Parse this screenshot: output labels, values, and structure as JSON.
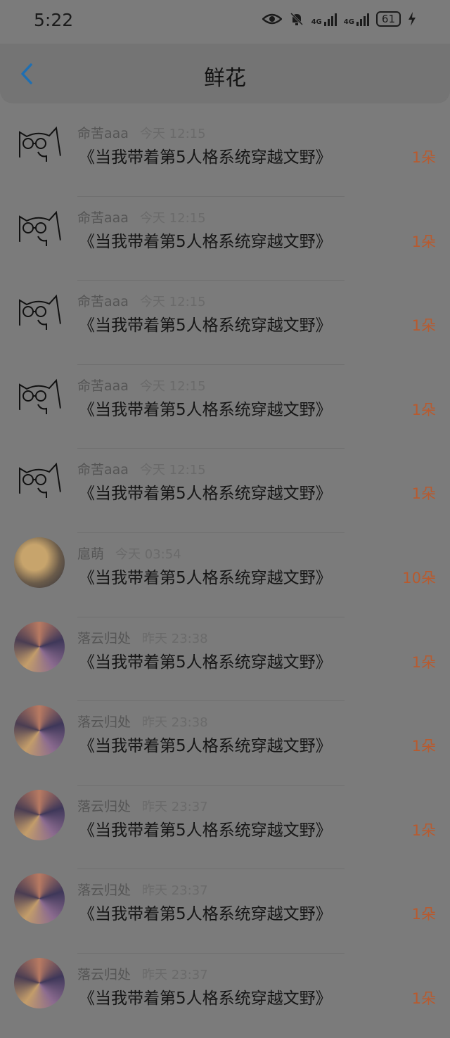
{
  "status_bar": {
    "time": "5:22",
    "battery": "61",
    "network_1": "4G",
    "network_2": "4G"
  },
  "header": {
    "title": "鲜花"
  },
  "items": [
    {
      "name": "命苦aaa",
      "time": "今天 12:15",
      "book": "《当我带着第5人格系统穿越文野》",
      "count": "1朵",
      "avatar": "cat-sketch"
    },
    {
      "name": "命苦aaa",
      "time": "今天 12:15",
      "book": "《当我带着第5人格系统穿越文野》",
      "count": "1朵",
      "avatar": "cat-sketch"
    },
    {
      "name": "命苦aaa",
      "time": "今天 12:15",
      "book": "《当我带着第5人格系统穿越文野》",
      "count": "1朵",
      "avatar": "cat-sketch"
    },
    {
      "name": "命苦aaa",
      "time": "今天 12:15",
      "book": "《当我带着第5人格系统穿越文野》",
      "count": "1朵",
      "avatar": "cat-sketch"
    },
    {
      "name": "命苦aaa",
      "time": "今天 12:15",
      "book": "《当我带着第5人格系统穿越文野》",
      "count": "1朵",
      "avatar": "cat-sketch"
    },
    {
      "name": "扈萌",
      "time": "今天 03:54",
      "book": "《当我带着第5人格系统穿越文野》",
      "count": "10朵",
      "avatar": "child-photo"
    },
    {
      "name": "落云归处",
      "time": "昨天 23:38",
      "book": "《当我带着第5人格系统穿越文野》",
      "count": "1朵",
      "avatar": "anime-art"
    },
    {
      "name": "落云归处",
      "time": "昨天 23:38",
      "book": "《当我带着第5人格系统穿越文野》",
      "count": "1朵",
      "avatar": "anime-art"
    },
    {
      "name": "落云归处",
      "time": "昨天 23:37",
      "book": "《当我带着第5人格系统穿越文野》",
      "count": "1朵",
      "avatar": "anime-art"
    },
    {
      "name": "落云归处",
      "time": "昨天 23:37",
      "book": "《当我带着第5人格系统穿越文野》",
      "count": "1朵",
      "avatar": "anime-art"
    },
    {
      "name": "落云归处",
      "time": "昨天 23:37",
      "book": "《当我带着第5人格系统穿越文野》",
      "count": "1朵",
      "avatar": "anime-art"
    }
  ],
  "colors": {
    "overlay": "#7b7b7b",
    "count": "#b85a2e",
    "back_arrow": "#1f6fb2"
  },
  "icons": [
    "eye-icon",
    "bell-muted-icon",
    "signal-icon",
    "battery-icon",
    "charging-icon",
    "back-arrow-icon"
  ]
}
